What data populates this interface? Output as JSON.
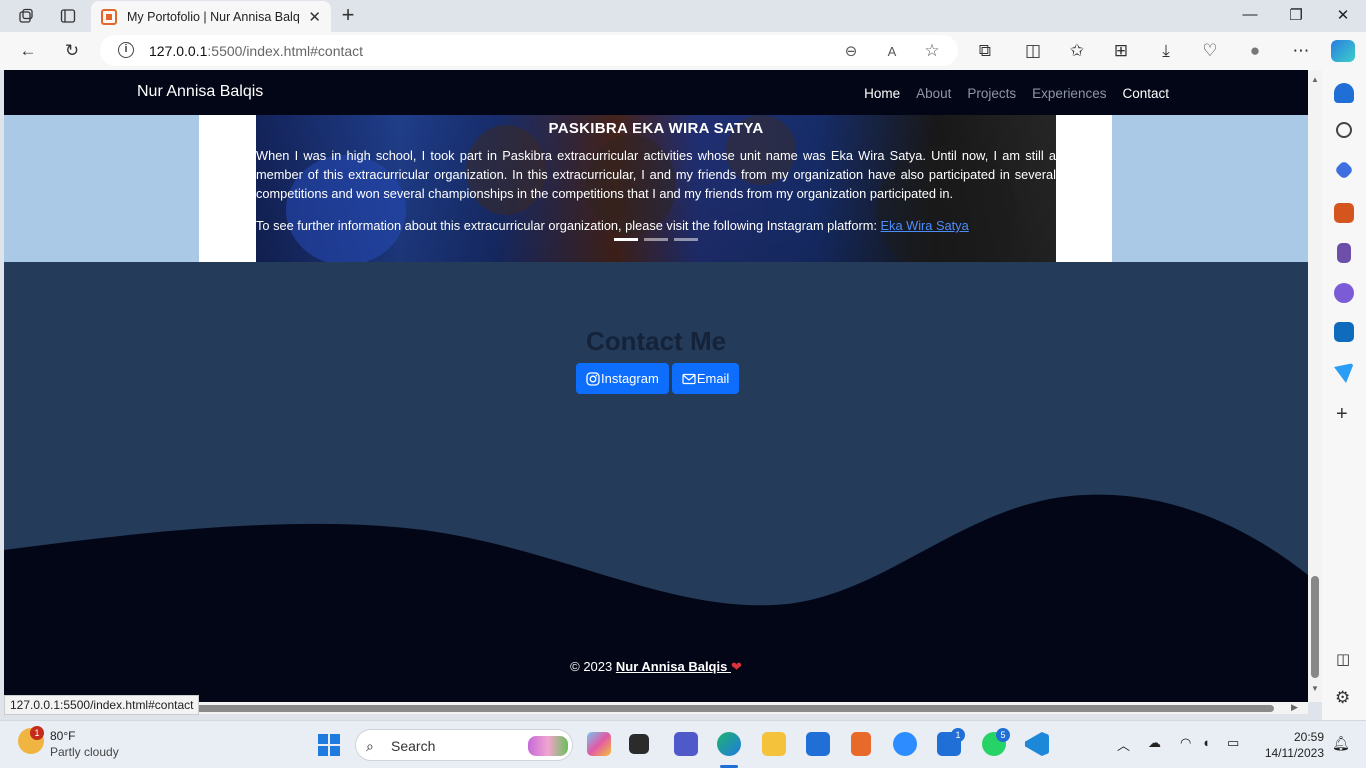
{
  "browser": {
    "tab_title": "My Portofolio | Nur Annisa Balqis",
    "url_host": "127.0.0.1",
    "url_path": ":5500/index.html#contact",
    "status_url": "127.0.0.1:5500/index.html#contact",
    "accent": "#0d6efd"
  },
  "navbar": {
    "brand": "Nur Annisa Balqis",
    "links": [
      "Home",
      "About",
      "Projects",
      "Experiences",
      "Contact"
    ]
  },
  "carousel": {
    "title": "PASKIBRA EKA WIRA SATYA",
    "paragraph1": "When I was in high school, I took part in Paskibra extracurricular activities whose unit name was Eka Wira Satya. Until now, I am still a member of this extracurricular organization. In this extracurricular, I and my friends from my organization have also participated in several competitions and won several championships in the competitions that I and my friends from my organization participated in.",
    "paragraph2_prefix": "To see further information about this extracurricular organization, please visit the following Instagram platform: ",
    "link_text": "Eka Wira Satya"
  },
  "contact": {
    "heading": "Contact Me",
    "instagram_label": "Instagram",
    "email_label": "Email"
  },
  "footer": {
    "copyright": "© 2023 ",
    "name": "Nur Annisa Balqis ",
    "heart": "❤"
  },
  "taskbar": {
    "weather_temp": "80°F",
    "weather_desc": "Partly cloudy",
    "weather_badge": "1",
    "search_placeholder": "Search",
    "mail_badge": "1",
    "whatsapp_badge": "5",
    "time": "20:59",
    "date": "14/11/2023"
  }
}
